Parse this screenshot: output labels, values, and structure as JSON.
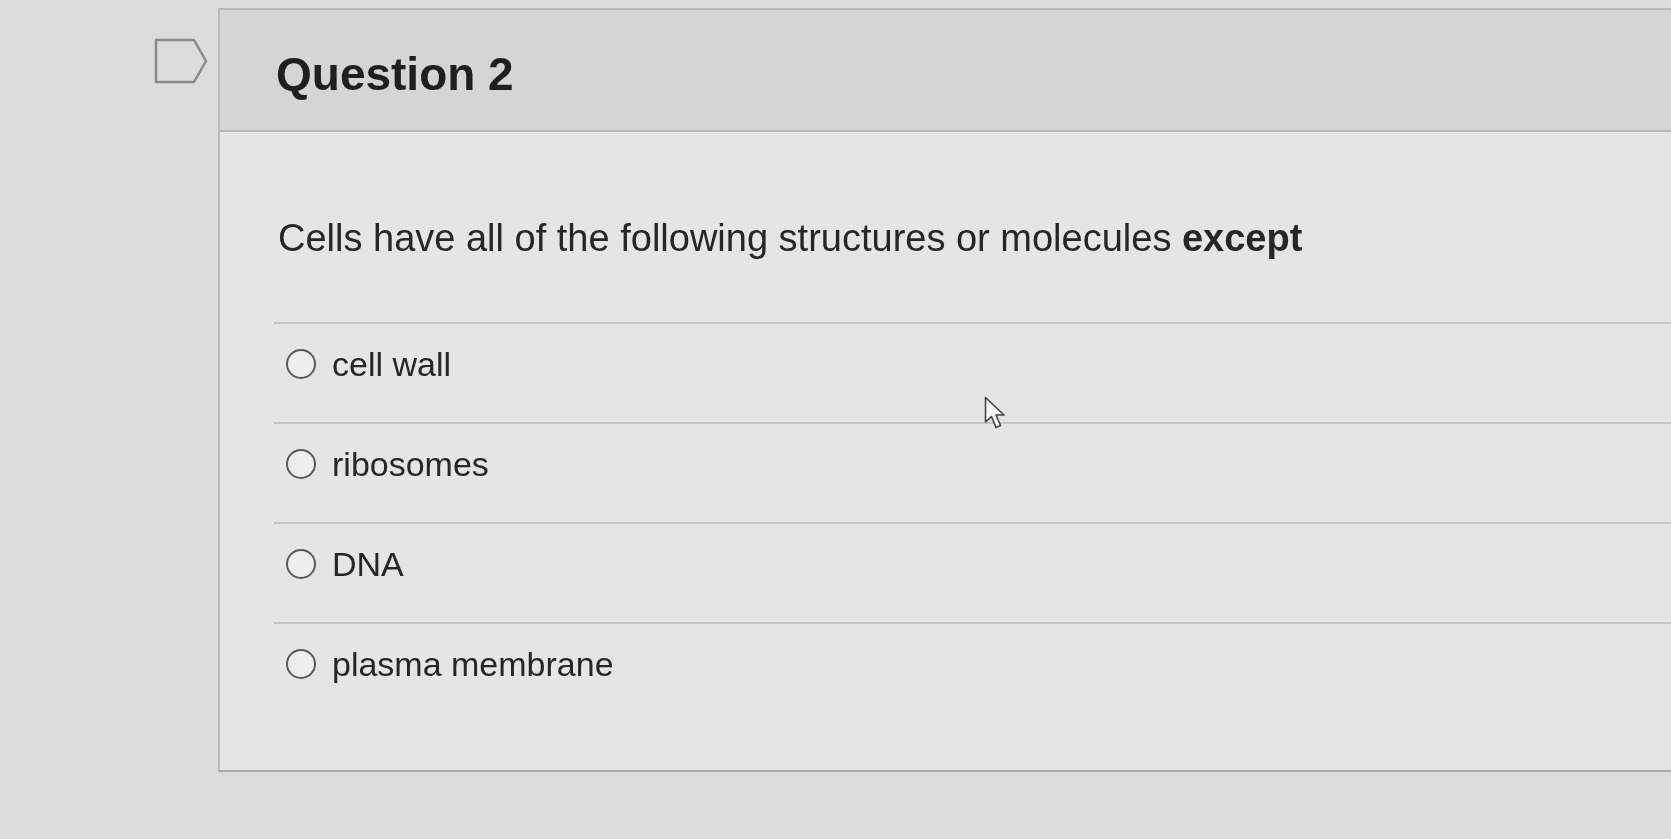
{
  "question": {
    "title": "Question 2",
    "text": "Cells have all of the following structures or molecules **except**",
    "options": [
      {
        "label": "cell wall",
        "selected": false
      },
      {
        "label": "ribosomes",
        "selected": false
      },
      {
        "label": "DNA",
        "selected": false
      },
      {
        "label": "plasma membrane",
        "selected": false
      }
    ]
  }
}
